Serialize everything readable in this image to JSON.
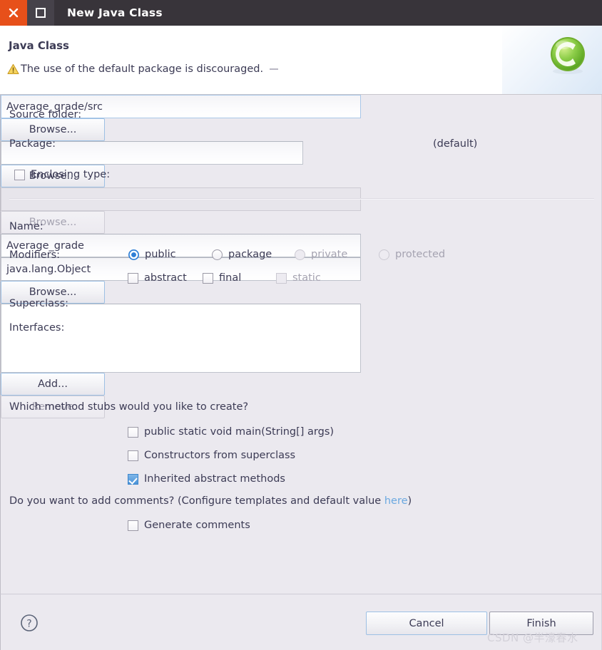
{
  "titlebar": {
    "title": "New Java Class",
    "close_icon": "close-x-icon",
    "maximize_icon": "maximize-square-icon"
  },
  "header": {
    "title": "Java Class",
    "message": "The use of the default package is discouraged.",
    "warning_icon": "warning-triangle-icon",
    "logo_icon": "java-class-green-c-icon",
    "logo_letter": "C"
  },
  "form": {
    "source_folder": {
      "label": "Source folder:",
      "value": "Average_grade/src",
      "button": "Browse..."
    },
    "package": {
      "label": "Package:",
      "value": "",
      "suffix": "(default)",
      "button": "Browse..."
    },
    "enclosing_type": {
      "label": "Enclosing type:",
      "value": "",
      "checked": false,
      "button": "Browse..."
    },
    "name": {
      "label": "Name:",
      "value": "Average_grade"
    },
    "modifiers": {
      "label": "Modifiers:",
      "radios": [
        {
          "label": "public",
          "selected": true,
          "enabled": true
        },
        {
          "label": "package",
          "selected": false,
          "enabled": true
        },
        {
          "label": "private",
          "selected": false,
          "enabled": false
        },
        {
          "label": "protected",
          "selected": false,
          "enabled": false
        }
      ],
      "checkboxes": [
        {
          "label": "abstract",
          "checked": false,
          "enabled": true
        },
        {
          "label": "final",
          "checked": false,
          "enabled": true
        },
        {
          "label": "static",
          "checked": false,
          "enabled": false
        }
      ]
    },
    "superclass": {
      "label": "Superclass:",
      "value": "java.lang.Object",
      "button": "Browse..."
    },
    "interfaces": {
      "label": "Interfaces:",
      "value": "",
      "add_button": "Add...",
      "remove_button": "Remove"
    },
    "stubs": {
      "question": "Which method stubs would you like to create?",
      "options": [
        {
          "label": "public static void main(String[] args)",
          "checked": false
        },
        {
          "label": "Constructors from superclass",
          "checked": false
        },
        {
          "label": "Inherited abstract methods",
          "checked": true
        }
      ]
    },
    "comments": {
      "question_before": "Do you want to add comments? (Configure templates and default value ",
      "link": "here",
      "question_after": ")",
      "option": {
        "label": "Generate comments",
        "checked": false
      }
    }
  },
  "footer": {
    "help_icon": "help-question-icon",
    "cancel": "Cancel",
    "finish": "Finish"
  },
  "watermark": "CSDN @半濠春水",
  "colors": {
    "accent": "#2f7fd6",
    "close": "#e7501a",
    "link": "#6aa8e0",
    "dialog_bg": "#ebe9ef",
    "titlebar_bg": "#38343a"
  }
}
